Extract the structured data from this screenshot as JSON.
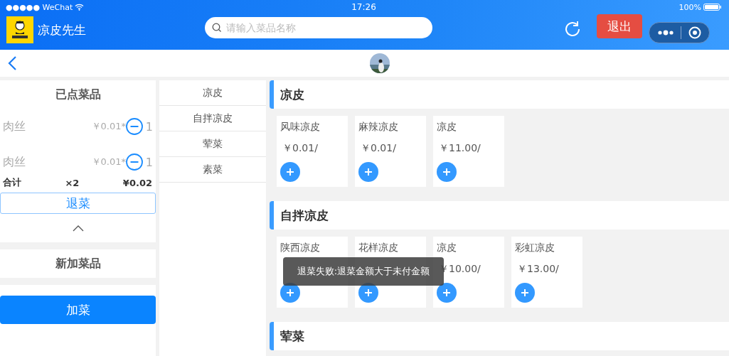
{
  "status_bar": {
    "carrier": "●●●●● WeChat",
    "time": "17:26",
    "battery": "100%"
  },
  "header": {
    "title": "凉皮先生",
    "search": {
      "placeholder": "请输入菜品名称"
    },
    "logout": "退出"
  },
  "ordered": {
    "title": "已点菜品",
    "items": [
      {
        "name": "肉丝",
        "price": "￥0.01*",
        "qty": "1"
      },
      {
        "name": "肉丝",
        "price": "￥0.01*",
        "qty": "1"
      }
    ],
    "total": {
      "label": "合计",
      "count": "×2",
      "amount": "¥0.02"
    },
    "return_button": "退菜"
  },
  "new_items": {
    "title": "新加菜品",
    "add_button": "加菜"
  },
  "categories": [
    {
      "label": "凉皮"
    },
    {
      "label": "自拌凉皮"
    },
    {
      "label": "荤菜"
    },
    {
      "label": "素菜"
    }
  ],
  "sections": [
    {
      "title": "凉皮",
      "dishes": [
        {
          "name": "风味凉皮",
          "price": "￥0.01/"
        },
        {
          "name": "麻辣凉皮",
          "price": "￥0.01/"
        },
        {
          "name": "凉皮",
          "price": "￥11.00/"
        }
      ]
    },
    {
      "title": "自拌凉皮",
      "dishes": [
        {
          "name": "陕西凉皮"
        },
        {
          "name": "花样凉皮"
        },
        {
          "name": "凉皮",
          "price": "￥10.00/"
        },
        {
          "name": "彩虹凉皮",
          "price": "￥13.00/"
        }
      ]
    },
    {
      "title": "荤菜"
    }
  ],
  "toast": "退菜失败:退菜金额大于未付金额"
}
